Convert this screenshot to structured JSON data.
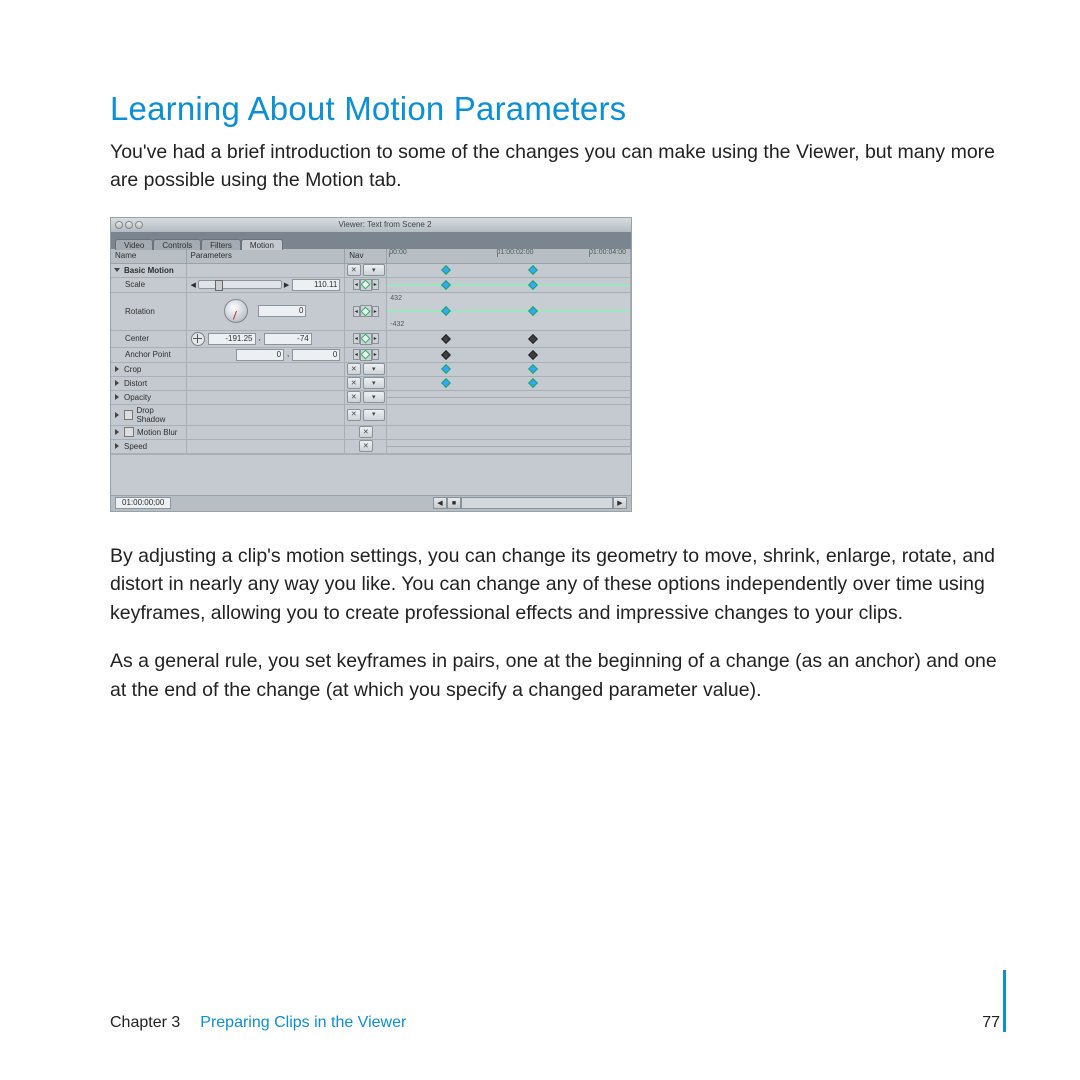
{
  "heading": "Learning About Motion Parameters",
  "intro": "You've had a brief introduction to some of the changes you can make using the Viewer, but many more are possible using the Motion tab.",
  "para2": "By adjusting a clip's motion settings, you can change its geometry to move, shrink, enlarge, rotate, and distort in nearly any way you like. You can change any of these options independently over time using keyframes, allowing you to create professional effects and impressive changes to your clips.",
  "para3": "As a general rule, you set keyframes in pairs, one at the beginning of a change (as an anchor) and one at the end of the change (at which you specify a changed parameter value).",
  "footer": {
    "chapter": "Chapter 3",
    "title": "Preparing Clips in the Viewer",
    "page": "77"
  },
  "viewer": {
    "title": "Viewer: Text from Scene 2",
    "tabs": [
      "Video",
      "Controls",
      "Filters",
      "Motion"
    ],
    "active_tab": "Motion",
    "columns": {
      "name": "Name",
      "parameters": "Parameters",
      "nav": "Nav"
    },
    "ruler": {
      "t0": "00:00",
      "t1": "01:00:02:00",
      "t2": "01:00:04:00"
    },
    "status_tc": "01:00:00;00",
    "rows": {
      "basic_motion": "Basic Motion",
      "scale": {
        "label": "Scale",
        "value": "110.11"
      },
      "rotation": {
        "label": "Rotation",
        "value": "0",
        "axis_hi": "432",
        "axis_lo": "-432"
      },
      "center": {
        "label": "Center",
        "x": "-191.25",
        "y": "-74"
      },
      "anchor": {
        "label": "Anchor Point",
        "x": "0",
        "y": "0"
      },
      "crop": "Crop",
      "distort": "Distort",
      "opacity": "Opacity",
      "drop_shadow": "Drop Shadow",
      "motion_blur": "Motion Blur",
      "speed": "Speed"
    }
  }
}
